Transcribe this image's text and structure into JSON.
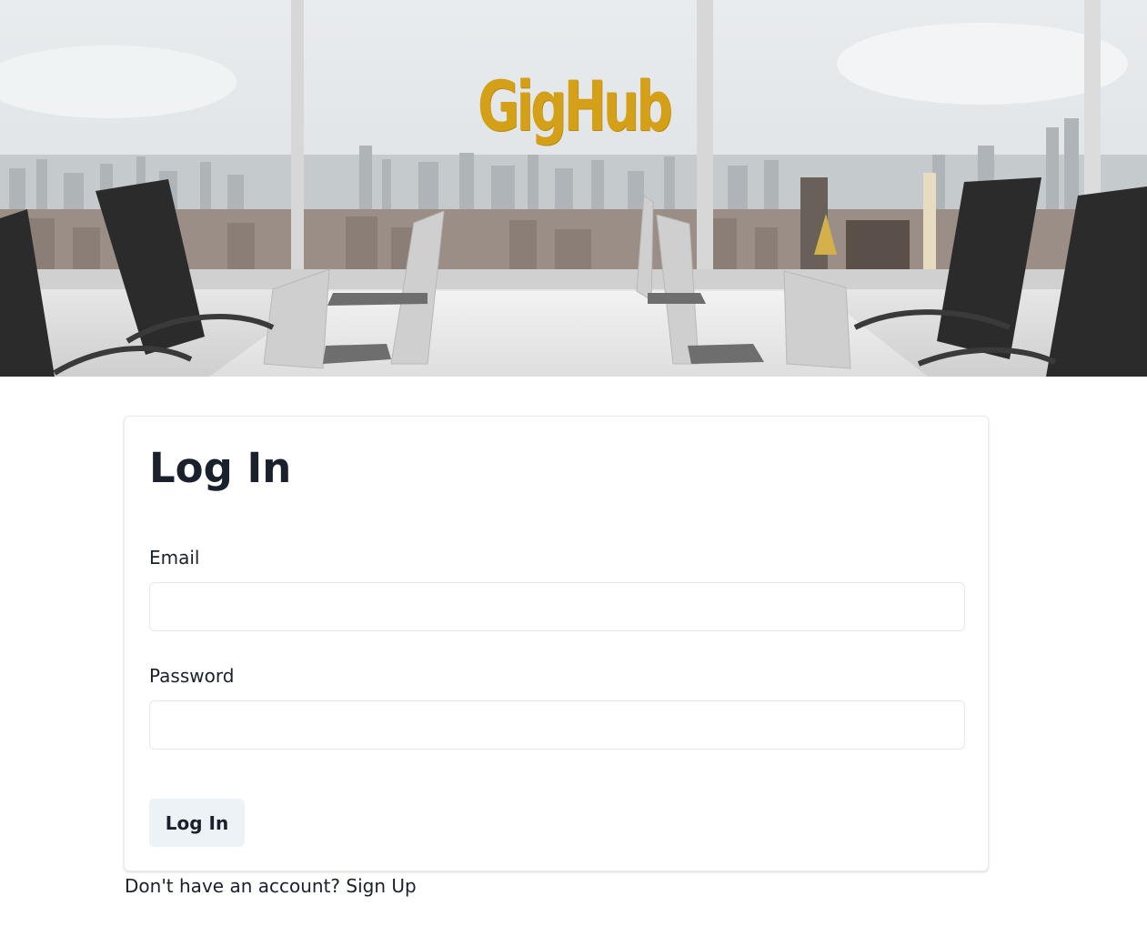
{
  "hero": {
    "brand": "GigHub",
    "brand_color": "#d4a017"
  },
  "login": {
    "title": "Log In",
    "email_label": "Email",
    "email_value": "",
    "password_label": "Password",
    "password_value": "",
    "submit_label": "Log In"
  },
  "footer": {
    "prompt": "Don't have an account? ",
    "signup_label": "Sign Up"
  },
  "colors": {
    "button_bg": "#edf2f7",
    "text": "#1a202c"
  }
}
